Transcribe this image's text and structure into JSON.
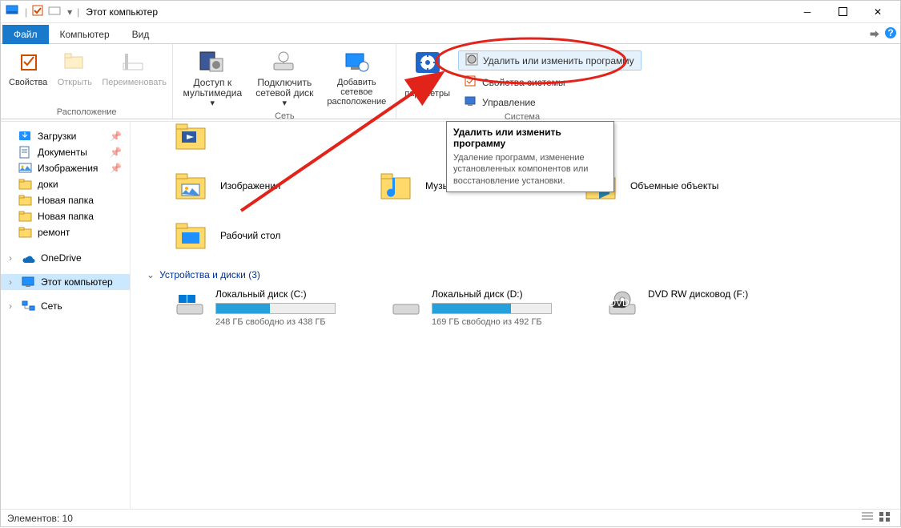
{
  "title": "Этот компьютер",
  "tabs": {
    "file": "Файл",
    "computer": "Компьютер",
    "view": "Вид"
  },
  "ribbon": {
    "location": {
      "properties": "Свойства",
      "open": "Открыть",
      "rename": "Переименовать",
      "group": "Расположение"
    },
    "network": {
      "media": "Доступ к мультимедиа",
      "mapdrive": "Подключить сетевой диск",
      "addnet": "Добавить сетевое расположение",
      "group": "Сеть"
    },
    "system": {
      "openSettings": "ть\nпараметры",
      "uninstall": "Удалить или изменить программу",
      "sysprops": "Свойства системы",
      "manage": "Управление",
      "group": "Система"
    }
  },
  "tooltip": {
    "title": "Удалить или изменить программу",
    "body": "Удаление программ, изменение установленных компонентов или восстановление установки."
  },
  "nav": {
    "downloads": "Загрузки",
    "documents": "Документы",
    "pictures": "Изображения",
    "doki": "доки",
    "newfolder1": "Новая папка",
    "newfolder2": "Новая папка",
    "remont": "ремонт",
    "onedrive": "OneDrive",
    "thispc": "Этот компьютер",
    "network": "Сеть"
  },
  "folders": {
    "images": "Изображения",
    "music": "Музыка",
    "volumetric": "Объемные объекты",
    "desktop": "Рабочий стол"
  },
  "drivesHeader": "Устройства и диски (3)",
  "drives": {
    "c": {
      "name": "Локальный диск (C:)",
      "free": "248 ГБ свободно из 438 ГБ",
      "fill": 45
    },
    "d": {
      "name": "Локальный диск (D:)",
      "free": "169 ГБ свободно из 492 ГБ",
      "fill": 66
    },
    "dvd": {
      "name": "DVD RW дисковод (F:)"
    }
  },
  "status": "Элементов: 10"
}
